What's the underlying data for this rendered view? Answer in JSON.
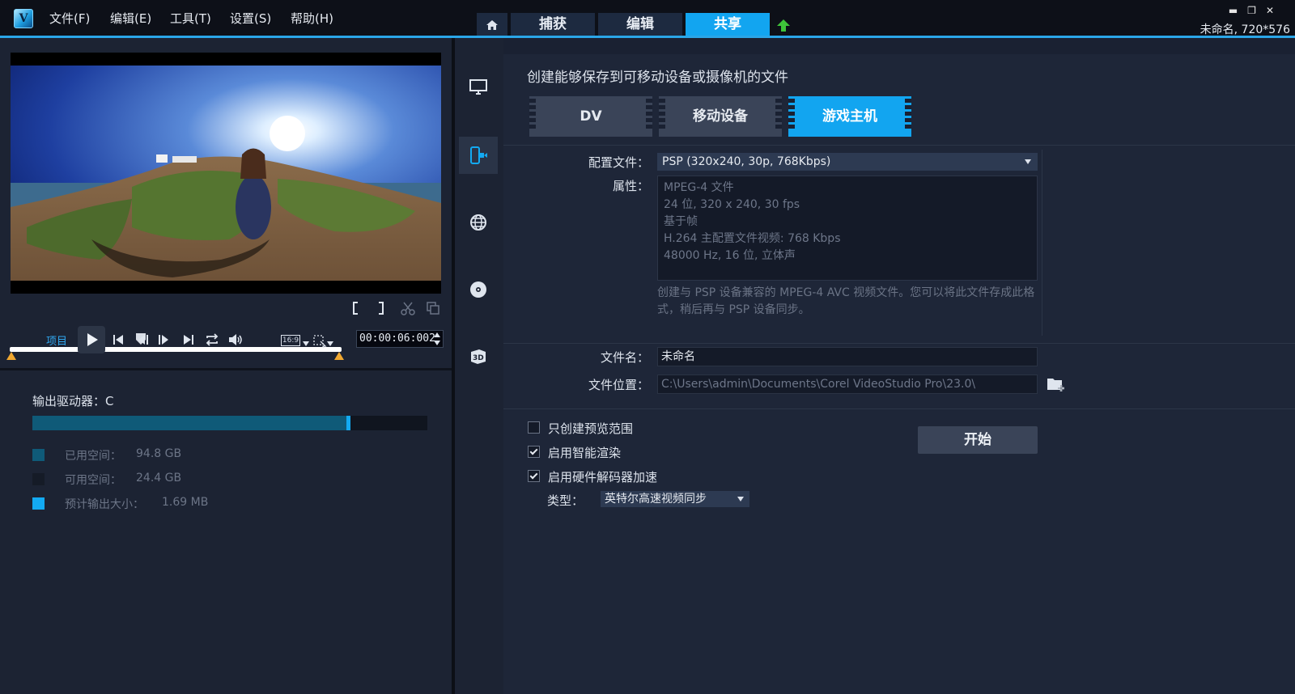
{
  "menu": {
    "file": "文件(F)",
    "edit": "编辑(E)",
    "tools": "工具(T)",
    "settings": "设置(S)",
    "help": "帮助(H)"
  },
  "tabs": {
    "capture": "捕获",
    "edit": "编辑",
    "share": "共享"
  },
  "project_info": "未命名, 720*576",
  "player": {
    "project_label": "项目",
    "aspect_ratio": "16:9",
    "timecode": "00:00:06:002"
  },
  "output": {
    "drive_label": "输出驱动器：C",
    "used_label": "已用空间：",
    "used_value": "94.8 GB",
    "free_label": "可用空间：",
    "free_value": "24.4 GB",
    "estimated_label": "预计输出大小：",
    "estimated_value": "1.69 MB",
    "used_fraction": 0.795,
    "colors": {
      "used": "#0f5a78",
      "free": "#151b27",
      "estimated": "#13aaf2"
    }
  },
  "share": {
    "title": "创建能够保存到可移动设备或摄像机的文件",
    "format_tabs": [
      "DV",
      "移动设备",
      "游戏主机"
    ],
    "active_format": "游戏主机",
    "profile_label": "配置文件：",
    "profile_value": "PSP (320x240, 30p, 768Kbps)",
    "attributes_label": "属性：",
    "attributes": [
      "MPEG-4 文件",
      "24 位, 320 x 240, 30 fps",
      "基于帧",
      "H.264 主配置文件视频: 768 Kbps",
      "48000 Hz, 16 位, 立体声"
    ],
    "description": "创建与 PSP 设备兼容的 MPEG-4 AVC 视频文件。您可以将此文件存成此格式，稍后再与 PSP 设备同步。",
    "filename_label": "文件名：",
    "filename_value": "未命名",
    "location_label": "文件位置：",
    "location_value": "C:\\Users\\admin\\Documents\\Corel VideoStudio Pro\\23.0\\",
    "options": [
      {
        "label": "只创建预览范围",
        "checked": false
      },
      {
        "label": "启用智能渲染",
        "checked": true
      },
      {
        "label": "启用硬件解码器加速",
        "checked": true
      }
    ],
    "type_label": "类型：",
    "type_value": "英特尔高速视频同步",
    "start_label": "开始"
  },
  "colors": {
    "accent": "#12a5f0",
    "background": "#1c2333",
    "titlebar": "#0d1018"
  }
}
